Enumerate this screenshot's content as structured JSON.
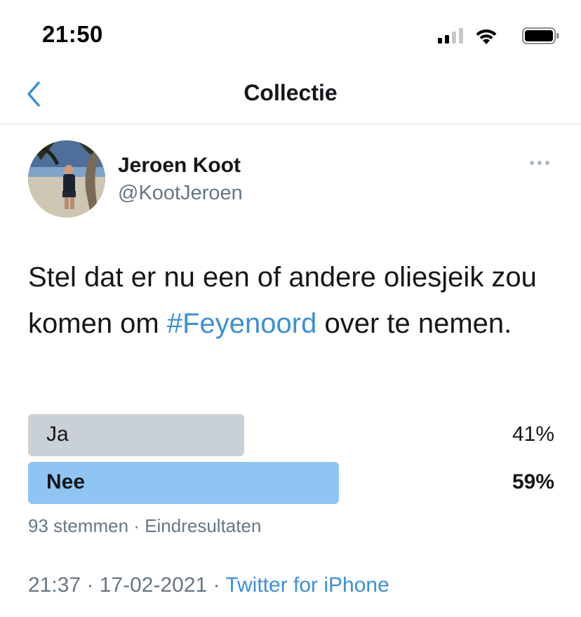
{
  "status_bar": {
    "time": "21:50"
  },
  "nav": {
    "title": "Collectie"
  },
  "tweet": {
    "author_name": "Jeroen Koot",
    "author_handle": "@KootJeroen",
    "text_before": "Stel dat er nu een of andere oliesjeik zou komen om ",
    "hashtag": "#Feyenoord",
    "text_after": " over te nemen.",
    "poll": {
      "options": [
        {
          "label": "Ja",
          "percent_text": "41%",
          "percent": 41,
          "winner": false
        },
        {
          "label": "Nee",
          "percent_text": "59%",
          "percent": 59,
          "winner": true
        }
      ],
      "votes": "93 stemmen",
      "separator": " · ",
      "status": "Eindresultaten"
    },
    "time": "21:37",
    "date": "17-02-2021",
    "meta_separator": " · ",
    "source": "Twitter for iPhone"
  },
  "colors": {
    "accent": "#3b8fd9",
    "poll_winner_bar": "#8ec5f2",
    "poll_other_bar": "#c9d0d6",
    "secondary_text": "#657786"
  },
  "icons": [
    "signal-icon",
    "wifi-icon",
    "battery-icon",
    "back-chevron-icon",
    "more-dots-icon"
  ]
}
